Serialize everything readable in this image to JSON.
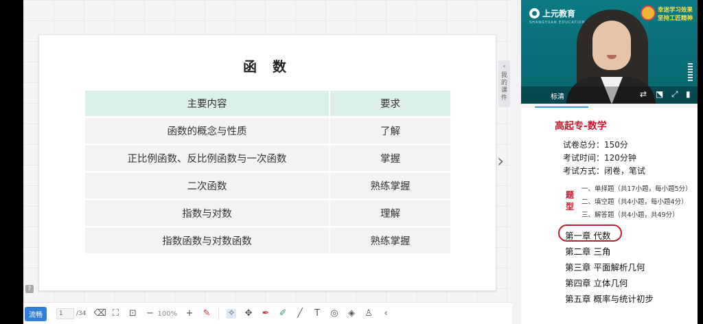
{
  "slide": {
    "title": "函 数",
    "table": {
      "headers": [
        "主要内容",
        "要求"
      ],
      "rows": [
        [
          "函数的概念与性质",
          "了解"
        ],
        [
          "正比例函数、反比例函数与一次函数",
          "掌握"
        ],
        [
          "二次函数",
          "熟练掌握"
        ],
        [
          "指数与对数",
          "理解"
        ],
        [
          "指数函数与对数函数",
          "熟练掌握"
        ]
      ]
    }
  },
  "side_tab": {
    "label": "我的课件"
  },
  "toolbar": {
    "mode_button": "流畅",
    "page_current": "1",
    "page_total": "/34",
    "zoom": "100%"
  },
  "video": {
    "brand": "上元教育",
    "brand_sub": "SHANGYUAN EDUCATION",
    "slogan_line1": "幸迷学习效果",
    "slogan_line2": "坚持工匠精神",
    "quality_label": "标清"
  },
  "outline": {
    "title": "高起专-数学",
    "exam_info": [
      "试卷总分：150分",
      "考试时间：120分钟",
      "考试方式：闭卷，笔试"
    ],
    "question_type_label": "题型",
    "question_types": [
      "一、单择题（共17小题，每小题5分）",
      "二、填空题（共4小题，每小题4分）",
      "三、解答题（共4小题，共49分）"
    ],
    "chapters": [
      "第一章 代数",
      "第二章 三角",
      "第三章 平面解析几何",
      "第四章 立体几何",
      "第五章 概率与统计初步"
    ]
  },
  "colors": {
    "header_row": "#dcefeb",
    "body_row": "#f3f3f3",
    "video_bg": "#0b7a83",
    "accent_red": "#c9182a",
    "toolbar_button": "#2f7fd8"
  },
  "icons": [
    "help-icon",
    "arrow-left-icon",
    "next-page-icon",
    "eraser-icon",
    "fit-screen-icon",
    "screenshot-icon",
    "zoom-out-icon",
    "zoom-in-icon",
    "clear-icon",
    "laser-pointer-icon",
    "move-icon",
    "pen-icon",
    "highlighter-icon",
    "line-icon",
    "text-icon",
    "circle-icon",
    "eraser-tool-icon",
    "stamp-icon",
    "collapse-icon",
    "switch-camera-icon",
    "exit-icon",
    "fullscreen-icon",
    "signal-icon",
    "microphone-icon"
  ]
}
